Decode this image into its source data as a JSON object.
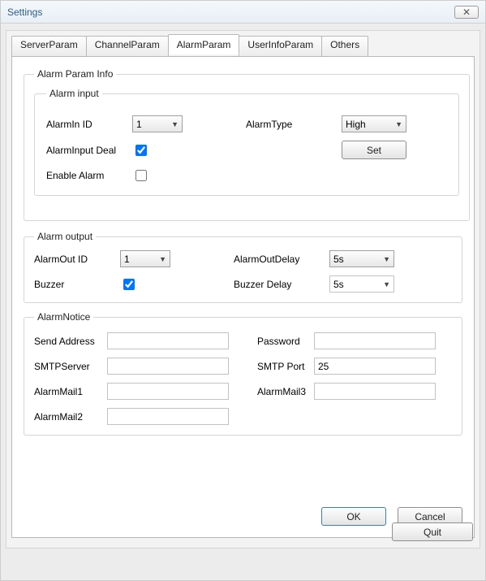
{
  "window": {
    "title": "Settings",
    "close_label": "✕",
    "quit_label": "Quit"
  },
  "tabs": {
    "serverparam": "ServerParam",
    "channelparam": "ChannelParam",
    "alarmparam": "AlarmParam",
    "userinfoparam": "UserInfoParam",
    "others": "Others"
  },
  "alarm_param_info": {
    "legend": "Alarm Param Info",
    "alarm_input": {
      "legend": "Alarm input",
      "alarmin_id_label": "AlarmIn ID",
      "alarmin_id_value": "1",
      "alarm_type_label": "AlarmType",
      "alarm_type_value": "High",
      "alarm_input_deal_label": "AlarmInput Deal",
      "alarm_input_deal_checked": true,
      "set_label": "Set",
      "enable_alarm_label": "Enable Alarm",
      "enable_alarm_checked": false
    },
    "alarm_output": {
      "legend": "Alarm output",
      "alarmout_id_label": "AlarmOut ID",
      "alarmout_id_value": "1",
      "alarmout_delay_label": "AlarmOutDelay",
      "alarmout_delay_value": "5s",
      "buzzer_label": "Buzzer",
      "buzzer_checked": true,
      "buzzer_delay_label": "Buzzer Delay",
      "buzzer_delay_value": "5s"
    },
    "alarm_notice": {
      "legend": "AlarmNotice",
      "send_address_label": "Send Address",
      "send_address_value": "",
      "password_label": "Password",
      "password_value": "",
      "smtpserver_label": "SMTPServer",
      "smtpserver_value": "",
      "smtp_port_label": "SMTP Port",
      "smtp_port_value": "25",
      "alarmmail1_label": "AlarmMail1",
      "alarmmail1_value": "",
      "alarmmail3_label": "AlarmMail3",
      "alarmmail3_value": "",
      "alarmmail2_label": "AlarmMail2",
      "alarmmail2_value": ""
    },
    "ok_label": "OK",
    "cancel_label": "Cancel"
  }
}
